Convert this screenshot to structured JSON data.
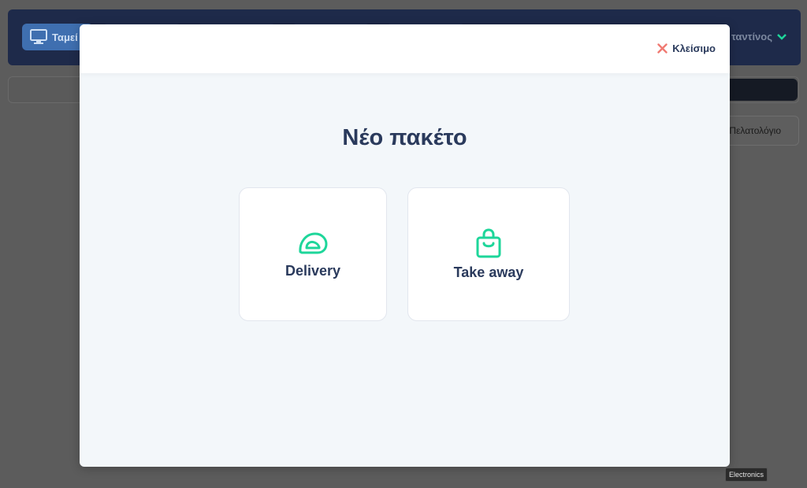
{
  "background": {
    "header_tab_label": "Ταμεί",
    "user_name": "ταντίνος",
    "customers_button": "Πελατολόγιο"
  },
  "modal": {
    "close_label": "Κλείσιμο",
    "title": "Νέο πακέτο",
    "options": [
      {
        "label": "Delivery",
        "icon": "helmet-icon"
      },
      {
        "label": "Take away",
        "icon": "shopping-bag-icon"
      }
    ]
  },
  "tooltip": "Electronics",
  "colors": {
    "accent": "#1ed69a",
    "close": "#f07a72",
    "text": "#2a3a5c",
    "header": "#1e2a4a"
  }
}
